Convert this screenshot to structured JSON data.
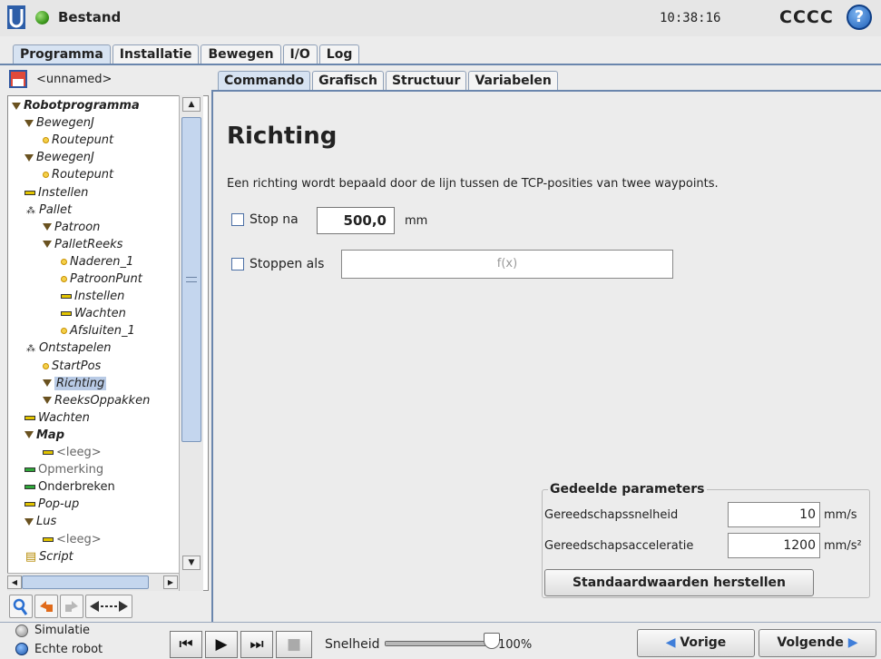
{
  "header": {
    "file_menu_label": "Bestand",
    "time": "10:38:16",
    "robot_name": "CCCC",
    "help_symbol": "?"
  },
  "main_tabs": [
    {
      "label": "Programma",
      "active": true
    },
    {
      "label": "Installatie",
      "active": false
    },
    {
      "label": "Bewegen",
      "active": false
    },
    {
      "label": "I/O",
      "active": false
    },
    {
      "label": "Log",
      "active": false
    }
  ],
  "program": {
    "name": "<unnamed>"
  },
  "tree": [
    {
      "label": "Robotprogramma",
      "icon": "triangle",
      "level": 0,
      "bold": true
    },
    {
      "label": "BewegenJ",
      "icon": "triangle",
      "level": 1
    },
    {
      "label": "Routepunt",
      "icon": "waypoint",
      "level": 2
    },
    {
      "label": "BewegenJ",
      "icon": "triangle",
      "level": 1
    },
    {
      "label": "Routepunt",
      "icon": "waypoint",
      "level": 2
    },
    {
      "label": "Instellen",
      "icon": "bar",
      "level": 1
    },
    {
      "label": "Pallet",
      "icon": "pallet",
      "level": 1
    },
    {
      "label": "Patroon",
      "icon": "triangle",
      "level": 2
    },
    {
      "label": "PalletReeks",
      "icon": "triangle",
      "level": 2
    },
    {
      "label": "Naderen_1",
      "icon": "waypoint",
      "level": 3
    },
    {
      "label": "PatroonPunt",
      "icon": "waypoint",
      "level": 3
    },
    {
      "label": "Instellen",
      "icon": "bar",
      "level": 3
    },
    {
      "label": "Wachten",
      "icon": "bar",
      "level": 3
    },
    {
      "label": "Afsluiten_1",
      "icon": "waypoint",
      "level": 3
    },
    {
      "label": "Ontstapelen",
      "icon": "pallet",
      "level": 1
    },
    {
      "label": "StartPos",
      "icon": "waypoint",
      "level": 2
    },
    {
      "label": "Richting",
      "icon": "triangle",
      "level": 2,
      "selected": true
    },
    {
      "label": "ReeksOppakken",
      "icon": "triangle",
      "level": 2
    },
    {
      "label": "Wachten",
      "icon": "bar",
      "level": 1
    },
    {
      "label": "Map",
      "icon": "triangle",
      "level": 1,
      "bold": true
    },
    {
      "label": "<leeg>",
      "icon": "bar",
      "level": 2,
      "gray": true
    },
    {
      "label": "Opmerking",
      "icon": "bar-green",
      "level": 1,
      "gray": true
    },
    {
      "label": "Onderbreken",
      "icon": "bar-green",
      "level": 1,
      "normal": true
    },
    {
      "label": "Pop-up",
      "icon": "bar",
      "level": 1
    },
    {
      "label": "Lus",
      "icon": "triangle",
      "level": 1
    },
    {
      "label": "<leeg>",
      "icon": "bar",
      "level": 2,
      "gray": true
    },
    {
      "label": "Script",
      "icon": "script",
      "level": 1
    }
  ],
  "sub_tabs": [
    {
      "label": "Commando",
      "active": true
    },
    {
      "label": "Grafisch",
      "active": false
    },
    {
      "label": "Structuur",
      "active": false
    },
    {
      "label": "Variabelen",
      "active": false
    }
  ],
  "command": {
    "title": "Richting",
    "description": "Een richting wordt bepaald door de lijn tussen de TCP-posities van twee waypoints.",
    "stop_after": {
      "label": "Stop na",
      "value": "500,0",
      "unit": "mm",
      "checked": false
    },
    "stop_if": {
      "label": "Stoppen als",
      "placeholder": "f(x)",
      "checked": false
    }
  },
  "shared_params": {
    "title": "Gedeelde parameters",
    "tool_speed": {
      "label": "Gereedschapssnelheid",
      "value": "10",
      "unit": "mm/s"
    },
    "tool_accel": {
      "label": "Gereedschapsacceleratie",
      "value": "1200",
      "unit": "mm/s²"
    },
    "reset_label": "Standaardwaarden herstellen"
  },
  "footer": {
    "simulation_label": "Simulatie",
    "real_robot_label": "Echte robot",
    "mode": "real",
    "speed_label": "Snelheid",
    "speed_value": "100%",
    "speed_fraction": 1.0,
    "prev_label": "Vorige",
    "next_label": "Volgende"
  },
  "colors": {
    "accent": "#6a86ad",
    "selection": "#b9cbe6",
    "waypoint": "#f4d04a",
    "arrow_blue": "#3f7ed9"
  }
}
